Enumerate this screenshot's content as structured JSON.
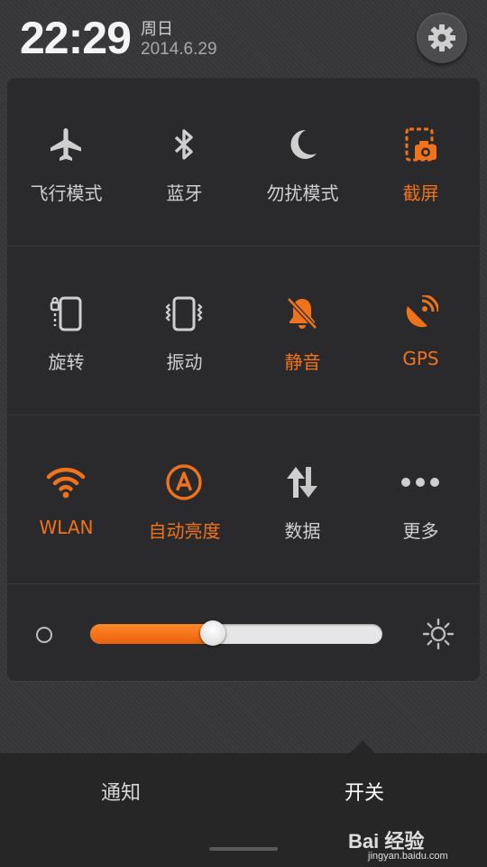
{
  "status": {
    "time": "22:29",
    "weekday": "周日",
    "date": "2014.6.29",
    "settings_icon": "gear-icon"
  },
  "colors": {
    "accent": "#f0731b",
    "off": "#cfcfcf",
    "panel": "#2a2a2c"
  },
  "toggles": [
    {
      "label": "飞行模式",
      "icon": "airplane-icon",
      "active": false
    },
    {
      "label": "蓝牙",
      "icon": "bluetooth-icon",
      "active": false
    },
    {
      "label": "勿扰模式",
      "icon": "moon-icon",
      "active": false
    },
    {
      "label": "截屏",
      "icon": "screenshot-icon",
      "active": true
    },
    {
      "label": "旋转",
      "icon": "rotate-icon",
      "active": false
    },
    {
      "label": "振动",
      "icon": "vibrate-icon",
      "active": false
    },
    {
      "label": "静音",
      "icon": "mute-icon",
      "active": true
    },
    {
      "label": "GPS",
      "icon": "gps-icon",
      "active": true
    },
    {
      "label": "WLAN",
      "icon": "wifi-icon",
      "active": true
    },
    {
      "label": "自动亮度",
      "icon": "auto-brightness-icon",
      "active": true
    },
    {
      "label": "数据",
      "icon": "data-icon",
      "active": false
    },
    {
      "label": "更多",
      "icon": "more-icon",
      "active": false
    }
  ],
  "brightness": {
    "level": 0.42,
    "low_icon": "brightness-low-icon",
    "high_icon": "brightness-high-icon"
  },
  "tabs": [
    {
      "label": "通知",
      "active": false
    },
    {
      "label": "开关",
      "active": true
    }
  ],
  "watermark": {
    "brand": "Bai 经验",
    "url": "jingyan.baidu.com"
  }
}
